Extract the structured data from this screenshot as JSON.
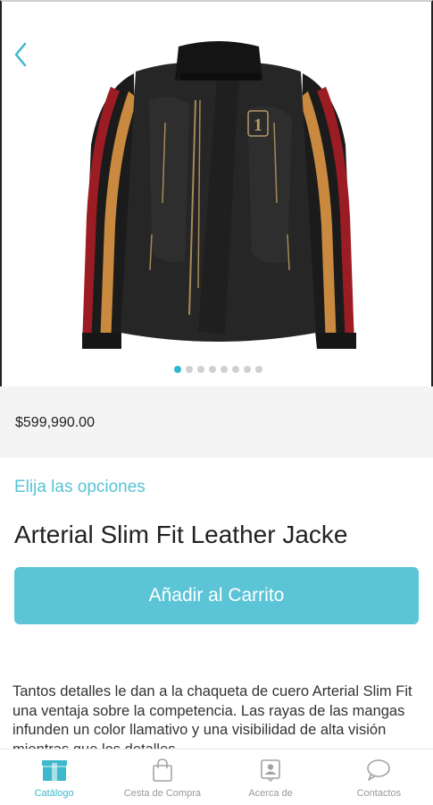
{
  "product": {
    "price": "$599,990.00",
    "options_link": "Elija las opciones",
    "title": "Arterial Slim Fit Leather Jacke",
    "add_to_cart": "Añadir al Carrito",
    "description": "Tantos detalles le dan a la chaqueta de cuero Arterial Slim Fit una ventaja sobre la competencia. Las rayas de las mangas infunden un color llamativo y una visibilidad de alta visión mientras que los detalles"
  },
  "gallery": {
    "image": "leather-jacket-photo",
    "dot_count": 8,
    "active_index": 0
  },
  "colors": {
    "accent": "#5bc4d6",
    "accent_text": "#58c3d3",
    "price_band": "#f4f4f4"
  },
  "tabbar": {
    "items": [
      {
        "label": "Catálogo",
        "icon": "storefront-icon",
        "active": true
      },
      {
        "label": "Cesta de Compra",
        "icon": "shopping-bag-icon",
        "active": false
      },
      {
        "label": "Acerca de",
        "icon": "contact-card-icon",
        "active": false
      },
      {
        "label": "Contactos",
        "icon": "chat-bubble-icon",
        "active": false
      }
    ]
  }
}
